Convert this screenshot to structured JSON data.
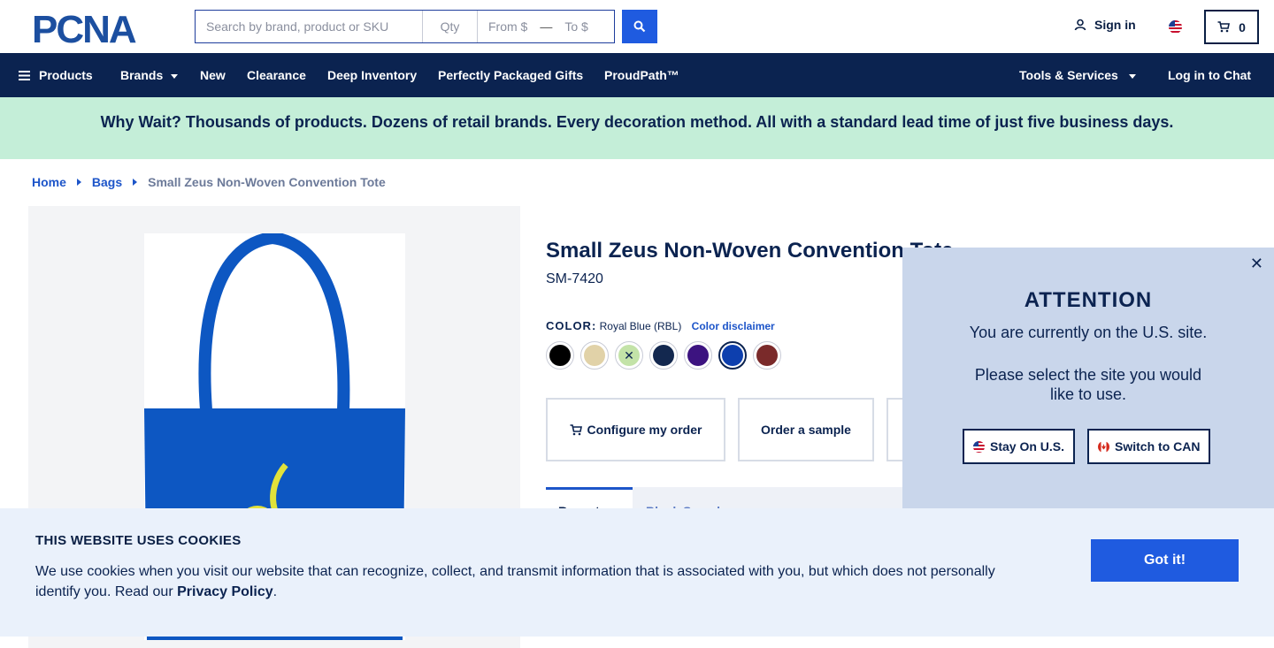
{
  "header": {
    "logo_text": "PCNA",
    "search_placeholder": "Search by brand, product or SKU",
    "qty_placeholder": "Qty",
    "from_placeholder": "From $",
    "to_placeholder": "To $",
    "signin_label": "Sign in",
    "cart_count": "0"
  },
  "nav": {
    "products": "Products",
    "brands": "Brands",
    "new": "New",
    "clearance": "Clearance",
    "deep_inventory": "Deep Inventory",
    "gifts": "Perfectly Packaged Gifts",
    "proudpath": "ProudPath™",
    "tools": "Tools & Services",
    "chat": "Log in to Chat"
  },
  "banner": "Why Wait? Thousands of products. Dozens of retail brands. Every decoration method. All with a standard lead time of just five business days.",
  "breadcrumb": {
    "home": "Home",
    "bags": "Bags",
    "current": "Small Zeus Non-Woven Convention Tote"
  },
  "product": {
    "title": "Small Zeus Non-Woven Convention Tote",
    "sku": "SM-7420",
    "color_label": "COLOR:",
    "color_value": "Royal Blue (RBL)",
    "color_disclaimer": "Color disclaimer",
    "swatches": [
      "#000000",
      "#e1d2a8",
      "#c3e3a8",
      "#13284f",
      "#3c1380",
      "#0d3fae",
      "#7a2a2a"
    ],
    "configure_label": "Configure my order",
    "sample_label": "Order a sample",
    "tab_recent": "Recent",
    "tab_other": "Blank Samples"
  },
  "modal": {
    "heading": "ATTENTION",
    "line1": "You are currently on the U.S. site.",
    "line2": "Please select the site you would like to use.",
    "stay_label": "Stay On U.S.",
    "switch_label": "Switch to CAN"
  },
  "cookies": {
    "heading": "THIS WEBSITE USES COOKIES",
    "body": "We use cookies when you visit our website that can recognize, collect, and transmit information that is associated with you, but which does not personally identify you. Read our ",
    "policy": "Privacy Policy",
    "button": "Got it!"
  }
}
